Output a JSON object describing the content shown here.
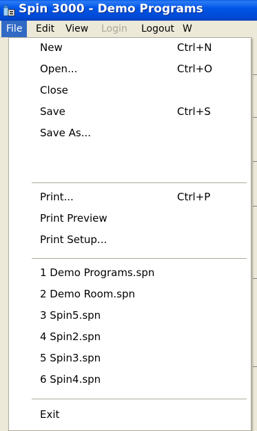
{
  "window": {
    "title": "Spin 3000 - Demo Programs"
  },
  "menubar": {
    "items": [
      {
        "label": "File",
        "state": "active"
      },
      {
        "label": "Edit",
        "state": "normal"
      },
      {
        "label": "View",
        "state": "normal"
      },
      {
        "label": "Login",
        "state": "disabled"
      },
      {
        "label": "Logout",
        "state": "normal"
      },
      {
        "label": "W",
        "state": "normal"
      }
    ]
  },
  "file_menu": {
    "items": [
      {
        "label": "New",
        "shortcut": "Ctrl+N"
      },
      {
        "label": "Open...",
        "shortcut": "Ctrl+O"
      },
      {
        "label": "Close",
        "shortcut": ""
      },
      {
        "label": "Save",
        "shortcut": "Ctrl+S"
      },
      {
        "label": "Save As...",
        "shortcut": ""
      },
      {
        "label": "Print...",
        "shortcut": "Ctrl+P"
      },
      {
        "label": "Print Preview",
        "shortcut": ""
      },
      {
        "label": "Print Setup...",
        "shortcut": ""
      },
      {
        "label": "1 Demo Programs.spn",
        "shortcut": ""
      },
      {
        "label": "2 Demo Room.spn",
        "shortcut": ""
      },
      {
        "label": "3 Spin5.spn",
        "shortcut": ""
      },
      {
        "label": "4 Spin2.spn",
        "shortcut": ""
      },
      {
        "label": "5 Spin3.spn",
        "shortcut": ""
      },
      {
        "label": "6 Spin4.spn",
        "shortcut": ""
      },
      {
        "label": "Exit",
        "shortcut": ""
      }
    ]
  },
  "colors": {
    "titlebar": "#0055e6",
    "menu_highlight": "#316ac5",
    "disabled_text": "#aca899",
    "menu_background": "#ffffff",
    "chrome": "#ece9d8"
  }
}
